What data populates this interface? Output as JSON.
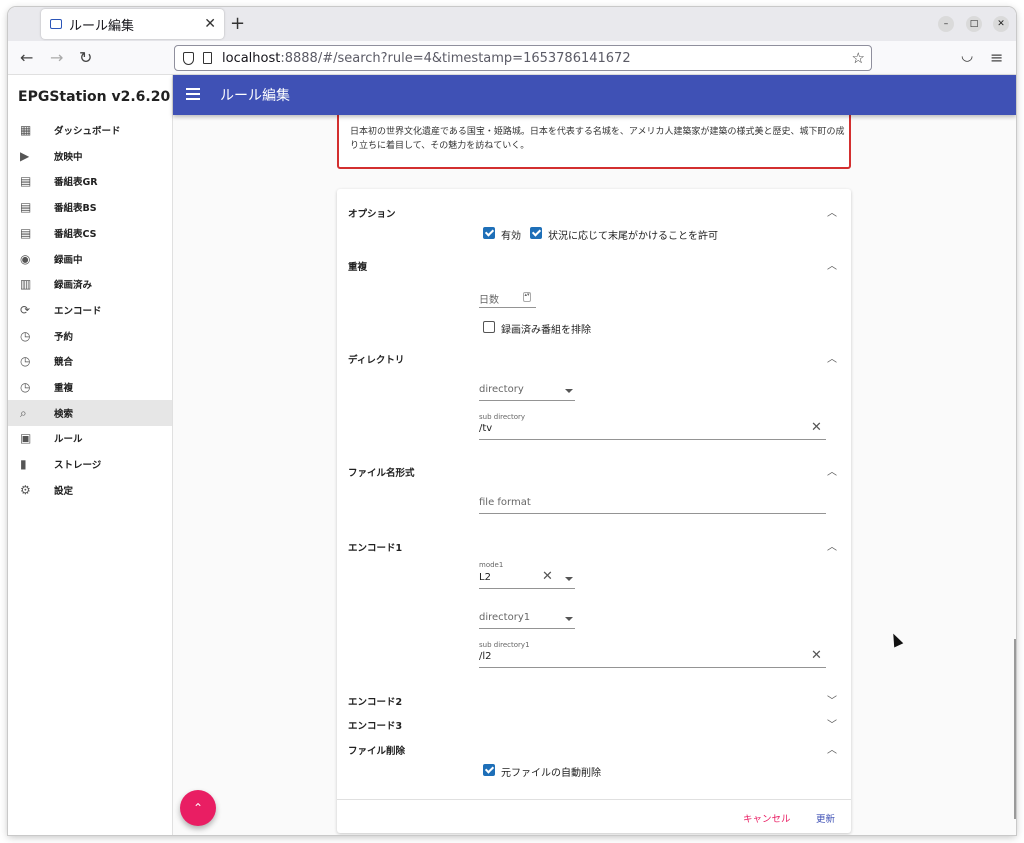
{
  "browser": {
    "tab_title": "ルール編集",
    "url_host": "localhost",
    "url_rest": ":8888/#/search?rule=4&timestamp=1653786141672"
  },
  "app": {
    "brand": "EPGStation v2.6.20",
    "page_title": "ルール編集"
  },
  "sidebar": {
    "items": [
      {
        "label": "ダッシュボード",
        "icon": "dashboard-icon"
      },
      {
        "label": "放映中",
        "icon": "live-tv-icon"
      },
      {
        "label": "番組表GR",
        "icon": "guide-icon"
      },
      {
        "label": "番組表BS",
        "icon": "guide-icon"
      },
      {
        "label": "番組表CS",
        "icon": "guide-icon"
      },
      {
        "label": "録画中",
        "icon": "record-icon"
      },
      {
        "label": "録画済み",
        "icon": "video-library-icon"
      },
      {
        "label": "エンコード",
        "icon": "sync-icon"
      },
      {
        "label": "予約",
        "icon": "clock-icon"
      },
      {
        "label": "競合",
        "icon": "clock-icon"
      },
      {
        "label": "重複",
        "icon": "clock-icon"
      },
      {
        "label": "検索",
        "icon": "search-icon"
      },
      {
        "label": "ルール",
        "icon": "calendar-icon"
      },
      {
        "label": "ストレージ",
        "icon": "sd-card-icon"
      },
      {
        "label": "設定",
        "icon": "gear-icon"
      }
    ],
    "active_index": 11
  },
  "program": {
    "description": "日本初の世界文化遺産である国宝・姫路城。日本を代表する名城を、アメリカ人建築家が建築の様式美と歴史、城下町の成り立ちに着目して、その魅力を訪ねていく。"
  },
  "form": {
    "option": {
      "title": "オプション",
      "enabled_label": "有効",
      "allow_end_lack_label": "状況に応じて末尾がかけることを許可"
    },
    "duplicate": {
      "title": "重複",
      "days_placeholder": "日数",
      "exclude_label": "録画済み番組を排除"
    },
    "directory": {
      "title": "ディレクトリ",
      "directory_placeholder": "directory",
      "sub_directory_label": "sub directory",
      "sub_directory_value": "/tv"
    },
    "file_format": {
      "title": "ファイル名形式",
      "placeholder": "file format"
    },
    "encode1": {
      "title": "エンコード1",
      "mode_label": "mode1",
      "mode_value": "L2",
      "directory_placeholder": "directory1",
      "sub_directory_label": "sub directory1",
      "sub_directory_value": "/l2"
    },
    "encode2": {
      "title": "エンコード2"
    },
    "encode3": {
      "title": "エンコード3"
    },
    "delete_file": {
      "title": "ファイル削除",
      "auto_delete_label": "元ファイルの自動削除"
    },
    "cancel_label": "キャンセル",
    "update_label": "更新"
  },
  "colors": {
    "toolbar": "#3f51b5",
    "fab": "#e91e63",
    "checkbox": "#1e6fb8",
    "highlight_border": "#d32f2f"
  }
}
